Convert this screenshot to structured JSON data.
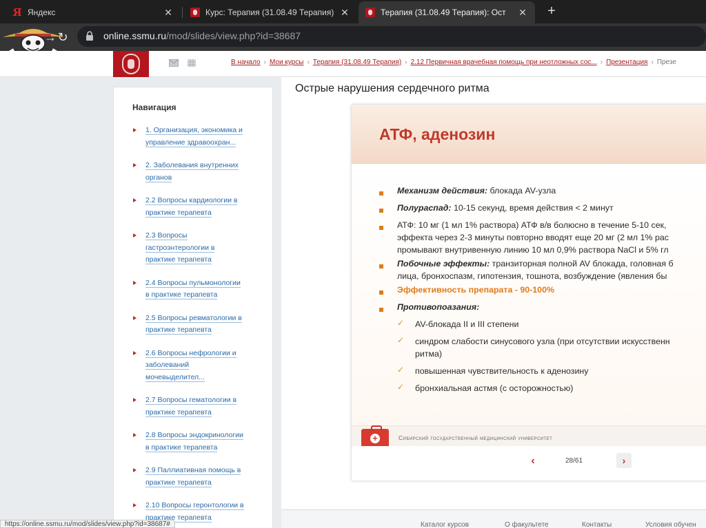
{
  "browser": {
    "tabs": [
      {
        "title": "Яндекс",
        "icon": "yandex-icon"
      },
      {
        "title": "Курс: Терапия (31.08.49 Терапия)",
        "icon": "ssmu-crest-icon"
      },
      {
        "title": "Терапия (31.08.49 Терапия): Ост",
        "icon": "ssmu-crest-icon",
        "active": true
      }
    ],
    "new_tab": "+",
    "url_host": "online.ssmu.ru",
    "url_path": "/mod/slides/view.php?id=38687"
  },
  "header": {
    "breadcrumb": [
      "В начало",
      "Мои курсы",
      "Терапия (31.08.49 Терапия)",
      "2.12 Первичная врачебная помощь при неотложных сос...",
      "Презентация"
    ],
    "breadcrumb_current": "Презе"
  },
  "navigation": {
    "heading": "Навигация",
    "items": [
      [
        "1. Организация, экономика и",
        "управление здравоохран..."
      ],
      [
        "2. Заболевания внутренних",
        "органов"
      ],
      [
        "2.2 Вопросы кардиологии в",
        "практике терапевта"
      ],
      [
        "2.3 Вопросы",
        "гастроэнтерологии в",
        "практике терапевта"
      ],
      [
        "2.4 Вопросы пульмонологии",
        "в практике терапевта"
      ],
      [
        "2.5 Вопросы ревматологии в",
        "практике терапевта"
      ],
      [
        "2.6 Вопросы нефрологии и",
        "заболеваний",
        "мочевыделител..."
      ],
      [
        "2.7 Вопросы гематологии в",
        "практике терапевта"
      ],
      [
        "2.8 Вопросы эндокринологии",
        "в практике терапевта"
      ],
      [
        "2.9 Паллиативная помощь в",
        "практике терапевта"
      ],
      [
        "2.10 Вопросы геронтологии в",
        "практике терапевта"
      ]
    ]
  },
  "main": {
    "title": "Острые нарушения сердечного ритма"
  },
  "slide": {
    "title": "АТФ, аденозин",
    "mechanism_label": "Механизм действия:",
    "mechanism_text": " блокада AV-узла",
    "halflife_label": "Полураспад:",
    "halflife_text": " 10-15 секунд, время действия < 2 минут",
    "dose_line1": "АТФ: 10 мг (1 мл 1% раствора) АТФ в/в болюсно в течение 5-10 сек,",
    "dose_line2": "эффекта через 2-3 минуты повторно вводят еще 20 мг (2 мл 1% рас",
    "dose_line3": "промывают внутривенную линию 10 мл 0,9% раствора NaCl и 5% гл",
    "side_label": "Побочные эффекты:",
    "side_text": " транзиторная полной AV блокада, головная б",
    "side_line2": "лица, бронхоспазм, гипотензия, тошнота, возбуждение (явления бы",
    "efficacy": "Эффективность препарата - 90-100%",
    "contra_label": "Противопоазания:",
    "contra_items": [
      "AV-блокада II и III степени",
      "синдром слабости синусового узла (при отсутствии искусственн",
      "ритма)",
      "повышенная чувствительность к аденозину",
      "бронхиальная астмя (с осторожностью)"
    ],
    "university": "Сибирский государственный медицинский университет",
    "page_indicator": "28/61",
    "prev": "‹",
    "next": "›"
  },
  "footer": {
    "links": [
      "Каталог курсов",
      "О факультете",
      "Контакты",
      "Условия обучен"
    ]
  },
  "status_url": "https://online.ssmu.ru/mod/slides/view.php?id=38687#",
  "colors": {
    "accent": "#b3161d",
    "slide_title": "#c0392b",
    "bullet": "#e07b1a",
    "link": "#2a6aa6"
  }
}
